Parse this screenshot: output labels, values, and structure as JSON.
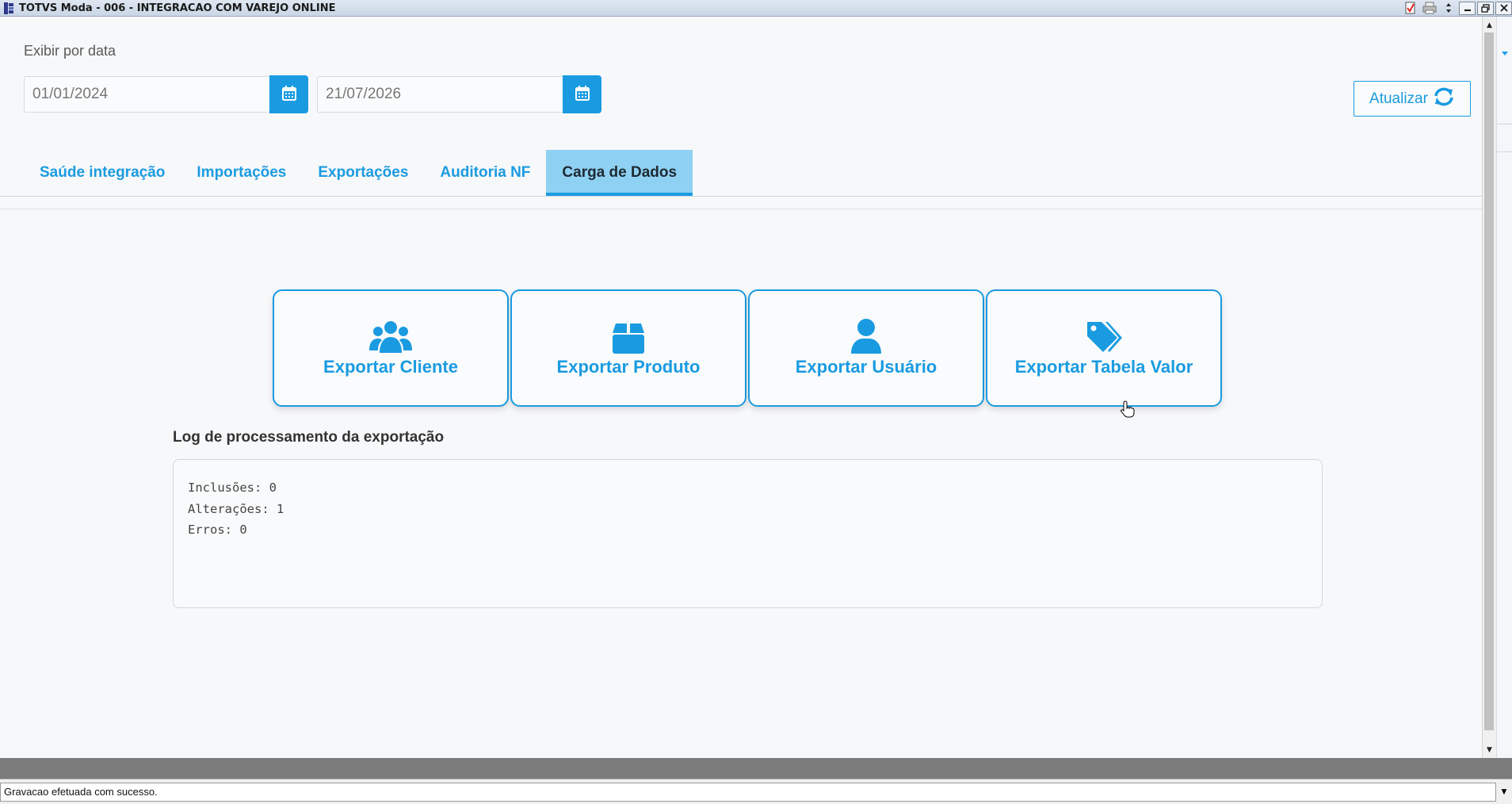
{
  "window": {
    "title": "TOTVS Moda - 006 - INTEGRACAO COM VAREJO ONLINE",
    "controls": [
      "minimize",
      "restore",
      "close"
    ]
  },
  "filter": {
    "label": "Exibir por data",
    "start_date": "01/01/2024",
    "end_date": "21/07/2026",
    "calendar_icon": "calendar-icon"
  },
  "refresh": {
    "label": "Atualizar",
    "icon": "refresh-icon"
  },
  "tabs": [
    {
      "label": "Saúde integração",
      "active": false
    },
    {
      "label": "Importações",
      "active": false
    },
    {
      "label": "Exportações",
      "active": false
    },
    {
      "label": "Auditoria NF",
      "active": false
    },
    {
      "label": "Carga de Dados",
      "active": true
    }
  ],
  "export_cards": [
    {
      "label": "Exportar Cliente",
      "icon": "users-icon"
    },
    {
      "label": "Exportar Produto",
      "icon": "box-icon"
    },
    {
      "label": "Exportar Usuário",
      "icon": "user-icon"
    },
    {
      "label": "Exportar Tabela Valor",
      "icon": "tags-icon"
    }
  ],
  "log": {
    "title": "Log de processamento da exportação",
    "lines": [
      "Inclusões: 0",
      "Alterações: 1",
      "Erros: 0"
    ]
  },
  "status_bar": {
    "message": "Gravacao efetuada com sucesso."
  },
  "colors": {
    "accent": "#1a9be1",
    "active_tab_bg": "#8fd1f3"
  }
}
